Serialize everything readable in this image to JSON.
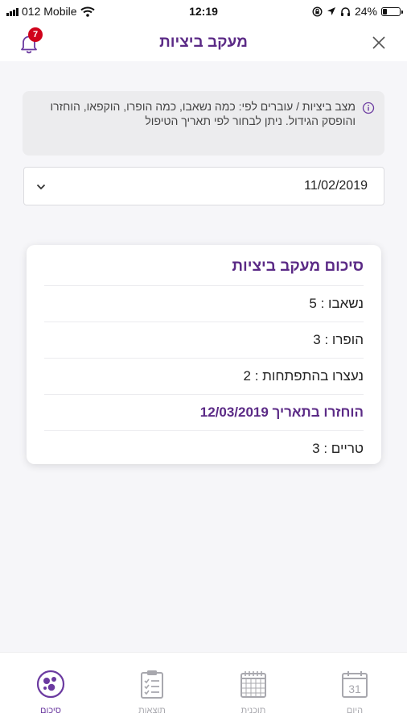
{
  "status_bar": {
    "carrier": "012 Mobile",
    "time": "12:19",
    "battery": "24%",
    "battery_level": 0.24
  },
  "header": {
    "title": "מעקב ביציות",
    "notification_count": "7"
  },
  "info": {
    "text": "מצב ביציות / עוברים לפי: כמה נשאבו, כמה הופרו, הוקפאו, הוחזרו והופסק הגידול. ניתן לבחור לפי תאריך הטיפול"
  },
  "date_select": {
    "value": "11/02/2019"
  },
  "summary": {
    "title": "סיכום מעקב ביציות",
    "rows": [
      {
        "text": "נשאבו : 5"
      },
      {
        "text": "הופרו : 3"
      },
      {
        "text": "נעצרו בהתפתחות : 2"
      },
      {
        "text": "הוחזרו בתאריך 12/03/2019"
      },
      {
        "text": "טריים : 3"
      }
    ]
  },
  "tabbar": {
    "tabs": [
      {
        "label": "סיכום"
      },
      {
        "label": "תוצאות"
      },
      {
        "label": "תוכנית"
      },
      {
        "label": "היום",
        "day": "31"
      }
    ]
  },
  "colors": {
    "accent": "#5b2a86",
    "badge": "#d0021b",
    "inactive": "#a8a8ae"
  }
}
